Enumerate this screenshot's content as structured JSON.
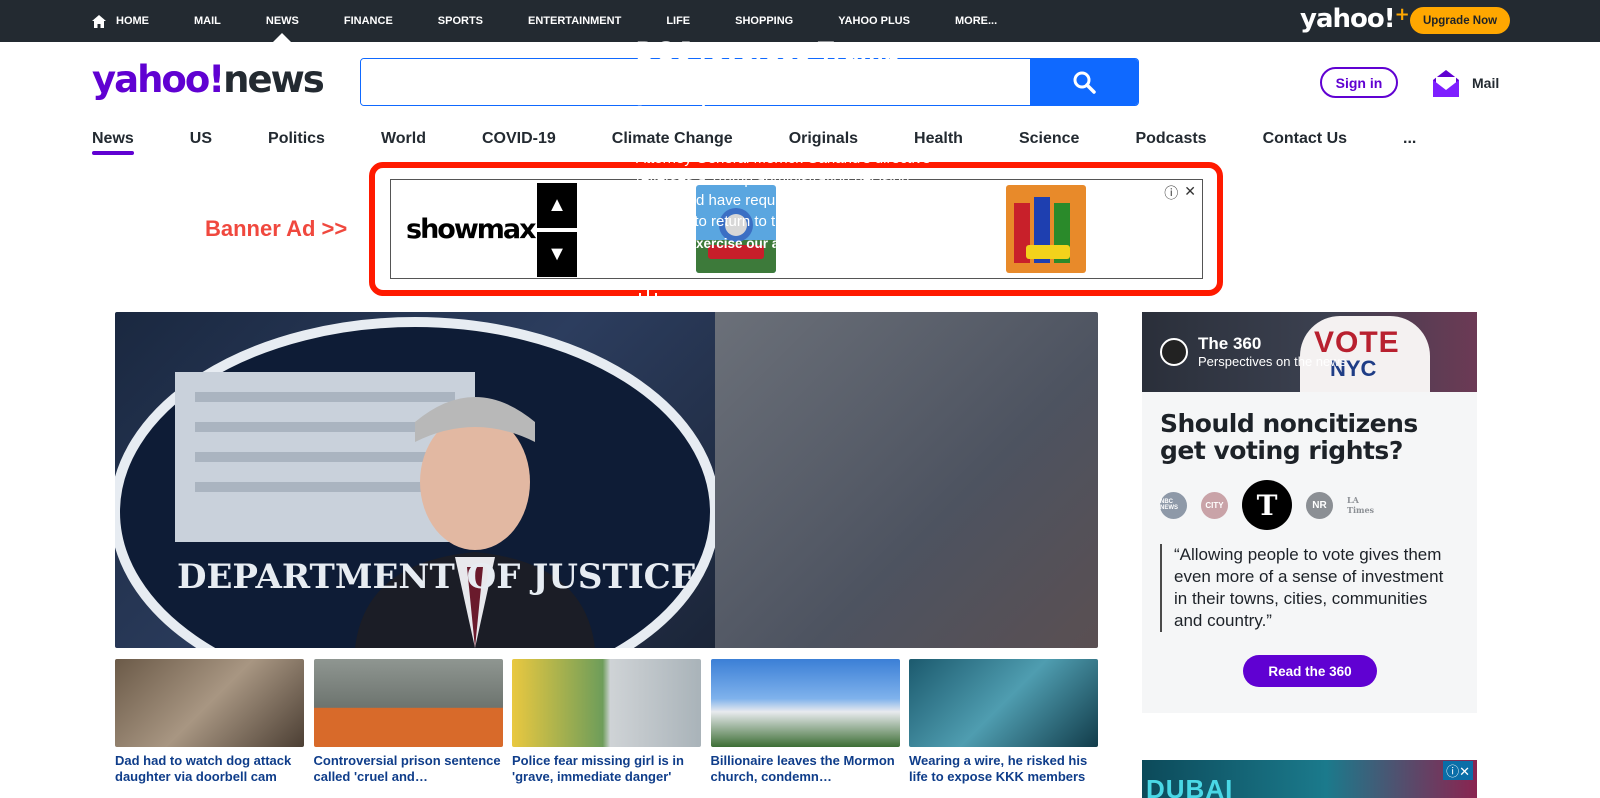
{
  "topnav": {
    "items": [
      {
        "label": "HOME"
      },
      {
        "label": "MAIL"
      },
      {
        "label": "NEWS"
      },
      {
        "label": "FINANCE"
      },
      {
        "label": "SPORTS"
      },
      {
        "label": "ENTERTAINMENT"
      },
      {
        "label": "LIFE"
      },
      {
        "label": "SHOPPING"
      },
      {
        "label": "YAHOO PLUS"
      },
      {
        "label": "MORE..."
      }
    ],
    "active": "NEWS",
    "logo": "yahoo!",
    "upgrade_label": "Upgrade Now"
  },
  "header": {
    "logo_yahoo": "yahoo!",
    "logo_news": "news",
    "search_value": "",
    "signin_label": "Sign in",
    "mail_label": "Mail"
  },
  "subnav": {
    "items": [
      "News",
      "US",
      "Politics",
      "World",
      "COVID-19",
      "Climate Change",
      "Originals",
      "Health",
      "Science",
      "Podcasts",
      "Contact Us",
      "..."
    ],
    "active": "News"
  },
  "banner": {
    "label": "Banner Ad >>",
    "brand": "showmax",
    "up_glyph": "▲",
    "down_glyph": "▼",
    "info_glyph": "ⓘ",
    "close_glyph": "✕"
  },
  "hero": {
    "title": "DOJ reverses Trump decision on released inmates",
    "description": "Attorney General Merrick Garland's directive reverses a Trump administration decision that would have required thousands of convicts to return to their…",
    "link": "'We will exercise our authority' »",
    "image_text": "DEPARTMENT OF JUSTICE"
  },
  "cards": [
    {
      "title": "Dad had to watch dog attack daughter via doorbell cam"
    },
    {
      "title": "Controversial prison sentence called 'cruel and…"
    },
    {
      "title": "Police fear missing girl is in 'grave, immediate danger'"
    },
    {
      "title": "Billionaire leaves the Mormon church, condemn…"
    },
    {
      "title": "Wearing a wire, he risked his life to expose KKK members"
    }
  ],
  "rail": {
    "brand_title": "The 360",
    "brand_subtitle": "Perspectives on the news",
    "sign_text_1": "VOTE",
    "sign_text_2": "NYC",
    "question": "Should noncitizens get voting rights?",
    "outlets": [
      "NBC NEWS",
      "CITY",
      "T",
      "NR",
      "LA Times"
    ],
    "quote": "“Allowing people to vote gives them even more of a sense of investment in their towns, cities, communities and country.”",
    "button_label": "Read the 360"
  },
  "dubai_ad": {
    "text": "DUBAI",
    "close_glyph": "ⓘ✕"
  },
  "colors": {
    "yahoo_purple": "#6001d2",
    "search_blue": "#0f69ff",
    "upgrade_yellow": "#ffa700",
    "highlight_red": "#ff1a00",
    "topbar_bg": "#232a31"
  }
}
